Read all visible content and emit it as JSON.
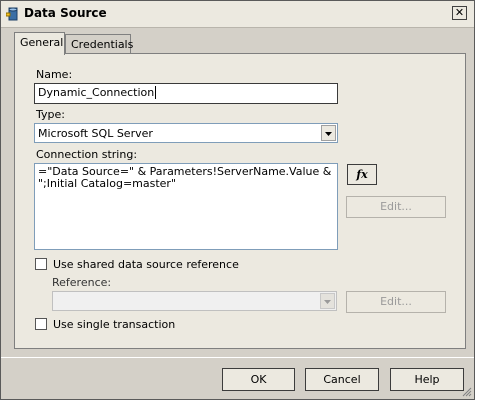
{
  "window": {
    "title": "Data Source",
    "close_glyph": "✕"
  },
  "tabs": [
    {
      "label": "General"
    },
    {
      "label": "Credentials"
    }
  ],
  "form": {
    "name_label": "Name:",
    "name_value": "Dynamic_Connection",
    "type_label": "Type:",
    "type_value": "Microsoft SQL Server",
    "connection_label": "Connection string:",
    "connection_value": "=\"Data Source=\" & Parameters!ServerName.Value & \";Initial Catalog=master\"",
    "fx_label": "fx",
    "edit_label": "Edit...",
    "shared_label": "Use shared data source reference",
    "reference_label": "Reference:",
    "reference_edit_label": "Edit...",
    "single_transaction_label": "Use single transaction"
  },
  "buttons": {
    "ok": "OK",
    "cancel": "Cancel",
    "help": "Help"
  }
}
